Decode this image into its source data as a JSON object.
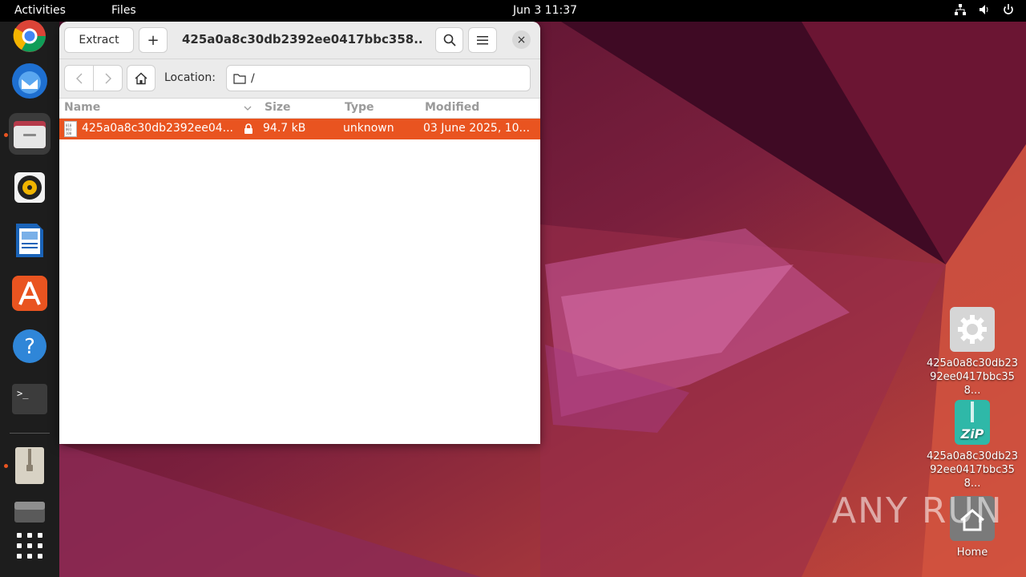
{
  "topbar": {
    "activities": "Activities",
    "app_menu": "Files",
    "clock": "Jun 3  11:37"
  },
  "window": {
    "extract_label": "Extract",
    "add_label": "+",
    "title": "425a0a8c30db2392ee0417bbc358...",
    "close_label": "×",
    "location_label": "Location:",
    "location_value": "/",
    "columns": {
      "name": "Name",
      "size": "Size",
      "type": "Type",
      "modified": "Modified"
    },
    "rows": [
      {
        "name": "425a0a8c30db2392ee04...",
        "size": "94.7 kB",
        "type": "unknown",
        "modified": "03 June 2025, 10..."
      }
    ]
  },
  "desktop": {
    "icons": [
      {
        "label": "425a0a8c30db2392ee0417bbc358...",
        "icon": "gear-icon"
      },
      {
        "label": "425a0a8c30db2392ee0417bbc358...",
        "icon": "zip-archive-icon"
      },
      {
        "label": "Home",
        "icon": "home-folder-icon"
      }
    ],
    "watermark": "ANY RUN"
  },
  "dock": {
    "items": [
      "chrome-icon",
      "thunderbird-icon",
      "files-icon",
      "rhythmbox-icon",
      "writer-icon",
      "app-center-icon",
      "help-icon",
      "terminal-icon",
      "archive-manager-icon",
      "drive-icon",
      "show-apps-icon"
    ]
  },
  "colors": {
    "accent": "#e95420",
    "topbar": "#000000",
    "dock": "#1d1d1d"
  }
}
